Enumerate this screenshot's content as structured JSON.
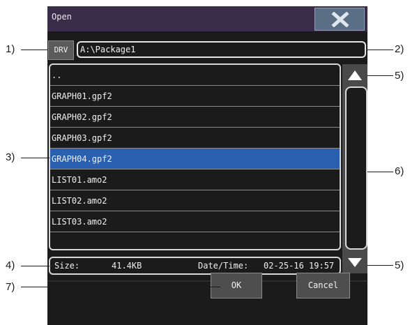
{
  "dialog": {
    "title": "Open",
    "close_icon": "close-x-icon",
    "drive_button": "DRV",
    "path": "A:\\Package1",
    "files": [
      {
        "name": "..",
        "selected": false
      },
      {
        "name": "GRAPH01.gpf2",
        "selected": false
      },
      {
        "name": "GRAPH02.gpf2",
        "selected": false
      },
      {
        "name": "GRAPH03.gpf2",
        "selected": false
      },
      {
        "name": "GRAPH04.gpf2",
        "selected": true
      },
      {
        "name": "LIST01.amo2",
        "selected": false
      },
      {
        "name": "LIST02.amo2",
        "selected": false
      },
      {
        "name": "LIST03.amo2",
        "selected": false
      },
      {
        "name": "",
        "selected": false
      }
    ],
    "info": {
      "size_label": "Size:",
      "size_value": "41.4KB",
      "date_label": "Date/Time:",
      "date_value": "02-25-16 19:57"
    },
    "ok_label": "OK",
    "cancel_label": "Cancel"
  },
  "callouts": {
    "c1": "1)",
    "c2": "2)",
    "c3": "3)",
    "c4": "4)",
    "c5a": "5)",
    "c5b": "5)",
    "c6": "6)",
    "c7": "7)"
  },
  "colors": {
    "selection": "#2b5fb0",
    "title_bar": "#3a2d4a",
    "close_button": "#5a6e85"
  }
}
